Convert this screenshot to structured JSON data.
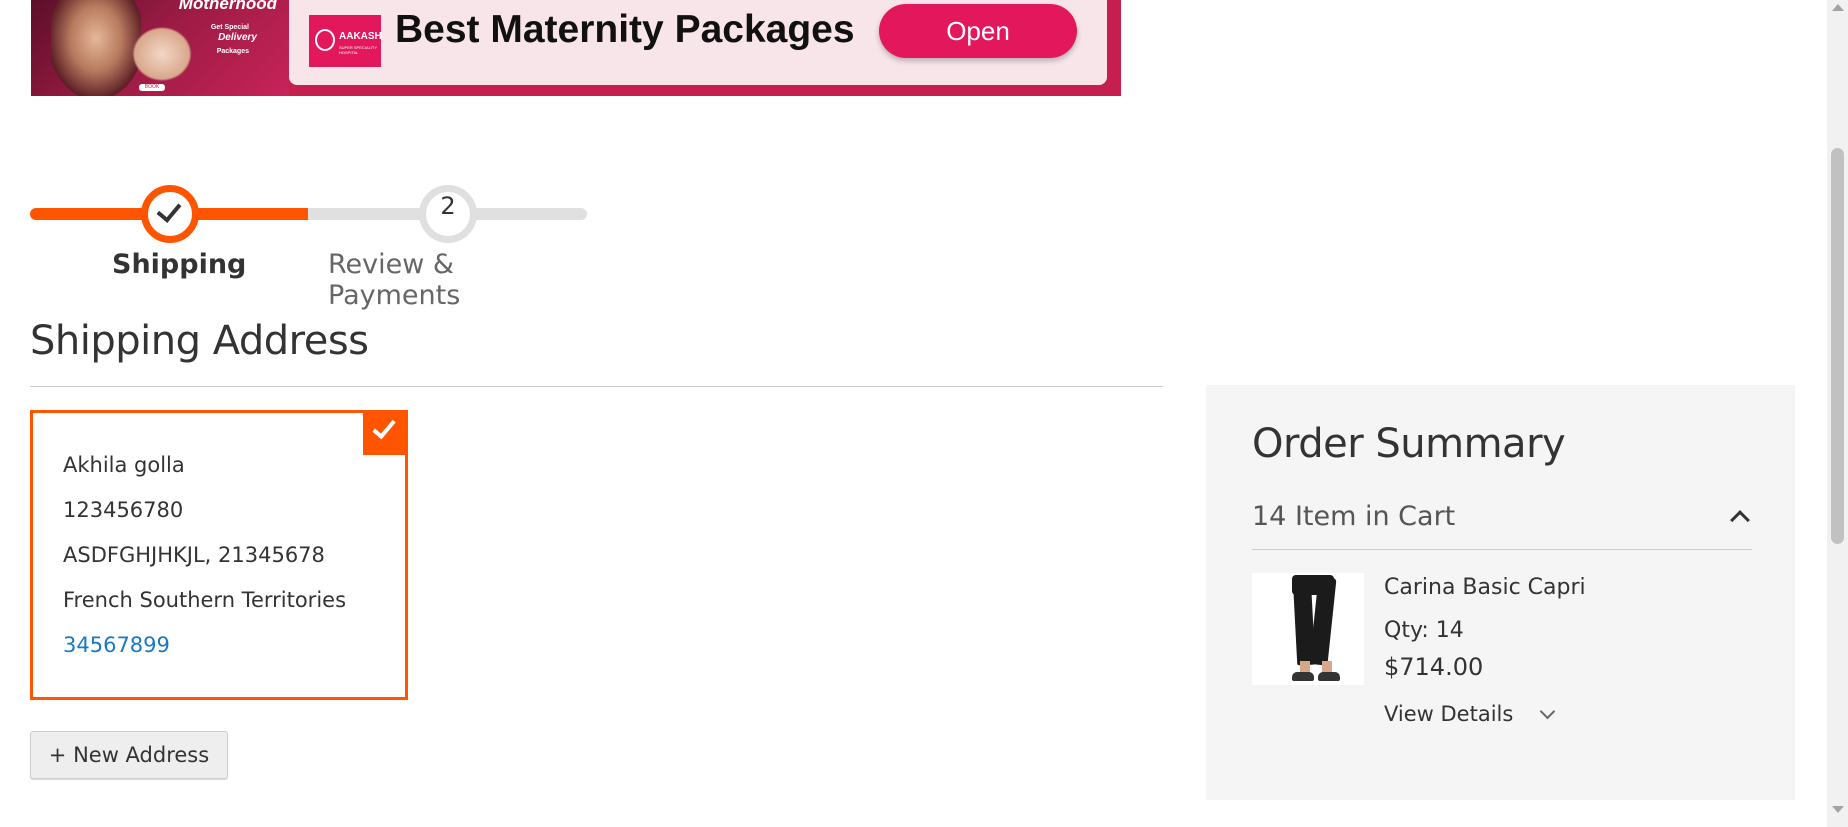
{
  "ad": {
    "photo_title": "Motherhood",
    "photo_line1": "Get Special",
    "photo_line2": "Delivery",
    "photo_line3": "Packages",
    "photo_button": "BOOK NOW",
    "brand_name": "AAKASH",
    "brand_sub": "SUPER SPECIALITY HOSPITAL",
    "headline": "Best Maternity Packages",
    "open_label": "Open",
    "accent_color": "#e3175c"
  },
  "progress": {
    "steps": [
      {
        "label": "Shipping",
        "state": "complete",
        "icon": "check-icon"
      },
      {
        "label": "Review & Payments",
        "state": "pending",
        "number": "2"
      }
    ],
    "completed_fraction": 0.5,
    "accent_color": "#ff5501"
  },
  "shipping": {
    "title": "Shipping Address",
    "address": {
      "name": "Akhila golla",
      "street": "123456780",
      "city_zip": "ASDFGHJHKJL, 21345678",
      "country": "French Southern Territories",
      "phone": "34567899",
      "selected": true
    },
    "new_address_label": "+ New Address"
  },
  "summary": {
    "title": "Order Summary",
    "cart_count": "14 Item in Cart",
    "items": [
      {
        "name": "Carina Basic Capri",
        "qty": "Qty: 14",
        "price": "$714.00",
        "view_details": "View Details"
      }
    ]
  }
}
